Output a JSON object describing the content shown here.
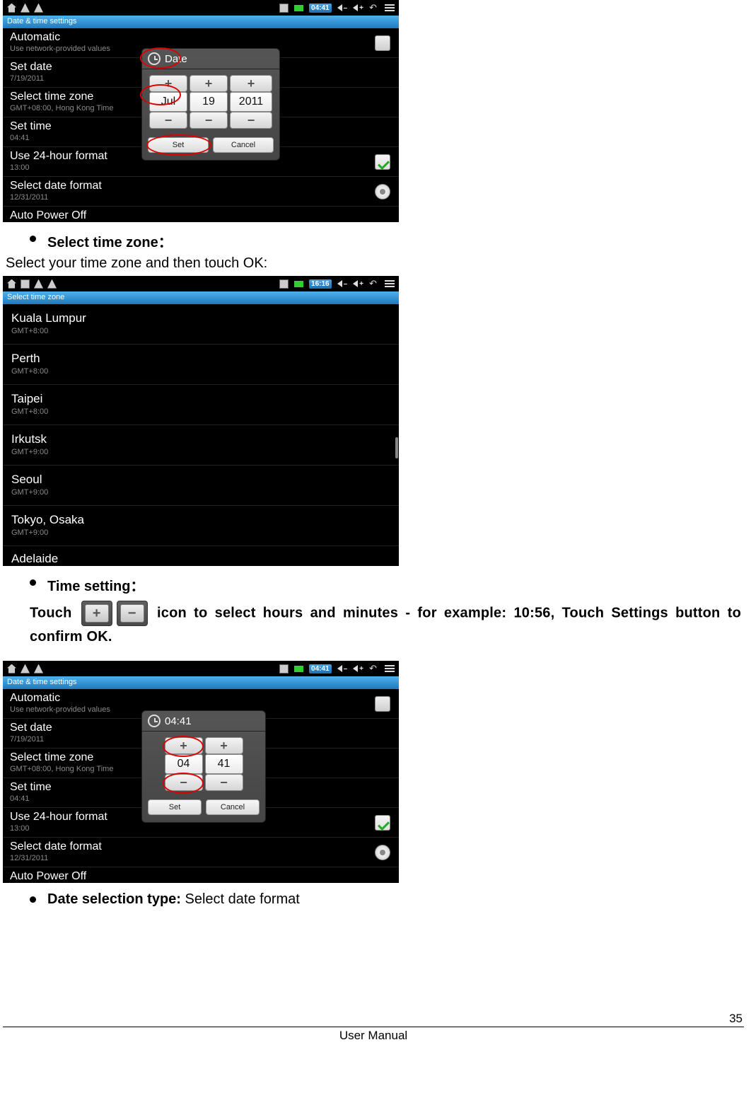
{
  "doc": {
    "bullet1_title": "Select time zone：",
    "bullet1_sub": "Select your time zone and then touch OK:",
    "bullet2_title": "Time setting：",
    "bullet2_body_a": "Touch ",
    "bullet2_body_b": " icon to select hours and minutes - for example: 10:56, Touch Settings button to confirm OK.",
    "bullet3_title": "Date selection type: ",
    "bullet3_rest": "Select date format",
    "footer": "User Manual",
    "page_num": "35"
  },
  "statusbar": {
    "time1": "04:41",
    "time2": "16:16",
    "time3": "04:41",
    "vol_minus": "–",
    "vol_plus": "+"
  },
  "s1": {
    "header": "Date & time settings",
    "items": [
      {
        "t": "Automatic",
        "s": "Use network-provided values",
        "icon": "chk"
      },
      {
        "t": "Set date",
        "s": "7/19/2011"
      },
      {
        "t": "Select time zone",
        "s": "GMT+08:00, Hong Kong Time"
      },
      {
        "t": "Set time",
        "s": "04:41"
      },
      {
        "t": "Use 24-hour format",
        "s": "13:00",
        "icon": "chkon"
      },
      {
        "t": "Select date format",
        "s": "12/31/2011",
        "icon": "radio"
      },
      {
        "t": "Auto Power Off"
      }
    ],
    "popup": {
      "title": "Date",
      "cols": [
        {
          "val": "Jul"
        },
        {
          "val": "19"
        },
        {
          "val": "2011"
        }
      ],
      "set": "Set",
      "cancel": "Cancel"
    }
  },
  "s2": {
    "header": "Select time zone",
    "zones": [
      {
        "n": "Kuala Lumpur",
        "o": "GMT+8:00"
      },
      {
        "n": "Perth",
        "o": "GMT+8:00"
      },
      {
        "n": "Taipei",
        "o": "GMT+8:00"
      },
      {
        "n": "Irkutsk",
        "o": "GMT+9:00"
      },
      {
        "n": "Seoul",
        "o": "GMT+9:00"
      },
      {
        "n": "Tokyo, Osaka",
        "o": "GMT+9:00"
      }
    ],
    "last": "Adelaide"
  },
  "s3": {
    "header": "Date & time settings",
    "items": [
      {
        "t": "Automatic",
        "s": "Use network-provided values",
        "icon": "chk"
      },
      {
        "t": "Set date",
        "s": "7/19/2011"
      },
      {
        "t": "Select time zone",
        "s": "GMT+08:00, Hong Kong Time"
      },
      {
        "t": "Set time",
        "s": "04:41"
      },
      {
        "t": "Use 24-hour format",
        "s": "13:00",
        "icon": "chkon"
      },
      {
        "t": "Select date format",
        "s": "12/31/2011",
        "icon": "radio"
      },
      {
        "t": "Auto Power Off"
      }
    ],
    "popup": {
      "title": "04:41",
      "cols": [
        {
          "val": "04"
        },
        {
          "val": "41"
        }
      ],
      "set": "Set",
      "cancel": "Cancel"
    }
  }
}
